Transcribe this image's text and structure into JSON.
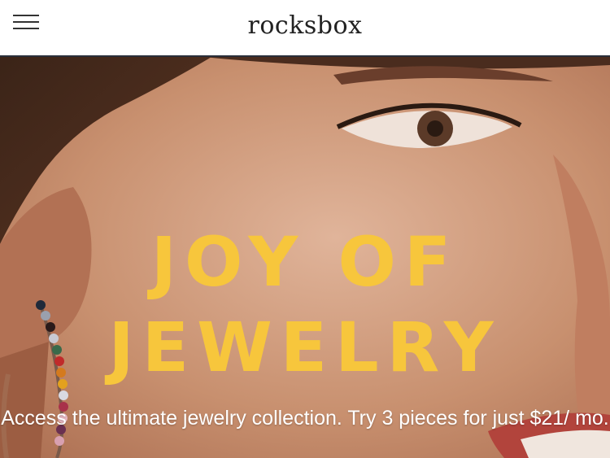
{
  "header": {
    "brand": "rocksbox",
    "menu_icon": "hamburger-menu-icon"
  },
  "hero": {
    "title_line1": "JOY OF",
    "title_line2": "JEWELRY",
    "subtitle": "Access the ultimate jewelry collection. Try 3 pieces for just $21/ mo.",
    "colors": {
      "title": "#f7c63c",
      "subtitle": "#ffffff",
      "header_border": "#2a2f3a"
    }
  }
}
